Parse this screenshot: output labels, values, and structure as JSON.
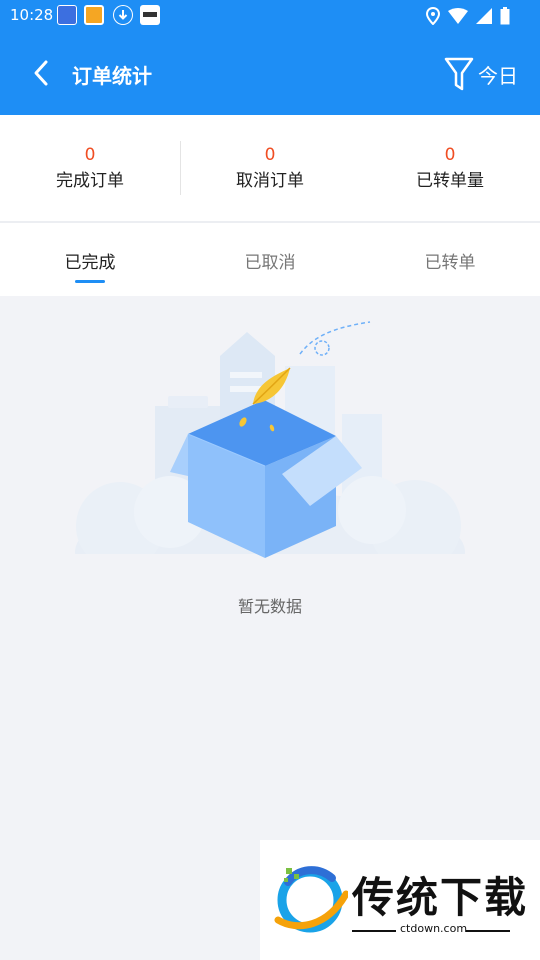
{
  "status_bar": {
    "time": "10:28",
    "notification_icons": [
      "app-notification-icon",
      "app-notification-icon",
      "download-icon",
      "app-notification-icon"
    ],
    "right_icons": [
      "location-icon",
      "wifi-icon",
      "signal-icon",
      "battery-icon"
    ]
  },
  "header": {
    "title": "订单统计",
    "filter_label": "今日",
    "color": "#1e8ef5"
  },
  "stats": [
    {
      "value": "0",
      "label": "完成订单"
    },
    {
      "value": "0",
      "label": "取消订单"
    },
    {
      "value": "0",
      "label": "已转单量"
    }
  ],
  "tabs": [
    {
      "label": "已完成",
      "active": true
    },
    {
      "label": "已取消",
      "active": false
    },
    {
      "label": "已转单",
      "active": false
    }
  ],
  "empty_state": {
    "message": "暂无数据"
  },
  "watermark": {
    "title": "传统下载",
    "url": "ctdown.com"
  },
  "colors": {
    "accent": "#1e8ef5",
    "stat_value": "#f04e23",
    "background": "#f2f3f7"
  }
}
